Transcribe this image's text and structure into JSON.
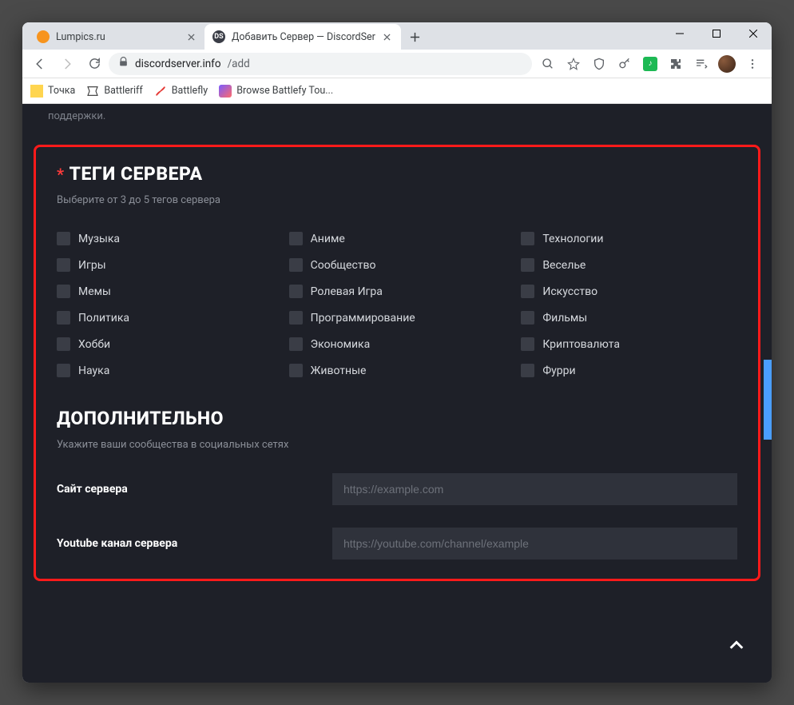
{
  "window": {
    "tabs": [
      {
        "title": "Lumpics.ru",
        "active": false,
        "favicon_color": "#f7941e"
      },
      {
        "title": "Добавить Сервер — DiscordSer",
        "active": true,
        "favicon_label": "DS",
        "favicon_bg": "#3a3d46"
      }
    ]
  },
  "addressbar": {
    "host": "discordserver.info",
    "path": "/add"
  },
  "bookmarks": [
    {
      "label": "Точка",
      "icon_color": "#ffd54f"
    },
    {
      "label": "Battleriff",
      "icon_color": "#333"
    },
    {
      "label": "Battlefly",
      "icon_color": "#e53935"
    },
    {
      "label": "Browse Battlefy Tou...",
      "icon_color": "#555"
    }
  ],
  "page": {
    "partial_top": "поддержки.",
    "tags_section": {
      "required_mark": "*",
      "title": "ТЕГИ СЕРВЕРА",
      "subtitle": "Выберите от 3 до 5 тегов сервера",
      "tags": [
        "Музыка",
        "Аниме",
        "Технологии",
        "Игры",
        "Сообщество",
        "Веселье",
        "Мемы",
        "Ролевая Игра",
        "Искусство",
        "Политика",
        "Программирование",
        "Фильмы",
        "Хобби",
        "Экономика",
        "Криптовалюта",
        "Наука",
        "Животные",
        "Фурри"
      ]
    },
    "extra_section": {
      "title": "ДОПОЛНИТЕЛЬНО",
      "subtitle": "Укажите ваши сообщества в социальных сетях",
      "fields": [
        {
          "label": "Сайт сервера",
          "placeholder": "https://example.com"
        },
        {
          "label": "Youtube канал сервера",
          "placeholder": "https://youtube.com/channel/example"
        }
      ]
    }
  }
}
